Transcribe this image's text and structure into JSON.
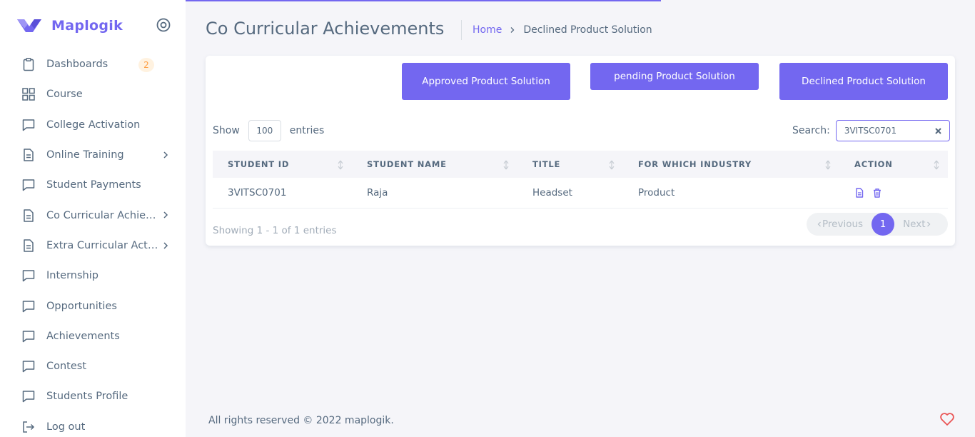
{
  "brand": {
    "name": "Maplogik",
    "accent": "#7367f0"
  },
  "sidebar": {
    "items": [
      {
        "label": "Dashboards",
        "icon": "clipboard-icon",
        "badge": "2"
      },
      {
        "label": "Course",
        "icon": "grid-icon"
      },
      {
        "label": "College Activation",
        "icon": "message-square-icon"
      },
      {
        "label": "Online Training",
        "icon": "file-text-icon",
        "has_submenu": true
      },
      {
        "label": "Student Payments",
        "icon": "message-square-icon"
      },
      {
        "label": "Co Curricular Achievements",
        "icon": "file-text-icon",
        "has_submenu": true
      },
      {
        "label": "Extra Curricular Activities",
        "icon": "file-text-icon",
        "has_submenu": true
      },
      {
        "label": "Internship",
        "icon": "message-square-icon"
      },
      {
        "label": "Opportunities",
        "icon": "message-square-icon"
      },
      {
        "label": "Achievements",
        "icon": "message-square-icon"
      },
      {
        "label": "Contest",
        "icon": "message-square-icon"
      },
      {
        "label": "Students Profile",
        "icon": "message-square-icon"
      },
      {
        "label": "Log out",
        "icon": "logout-icon"
      }
    ]
  },
  "header": {
    "title": "Co Curricular Achievements",
    "breadcrumb": {
      "home": "Home",
      "current": "Declined Product Solution"
    }
  },
  "tabs": {
    "approved": "Approved Product Solution",
    "pending": "pending Product Solution",
    "declined": "Declined Product Solution"
  },
  "table_controls": {
    "show_label": "Show",
    "length_value": "100",
    "entries_label": "entries",
    "search_label": "Search:",
    "search_value": "3VITSC0701"
  },
  "table": {
    "columns": [
      "STUDENT ID",
      "STUDENT NAME",
      "TITLE",
      "FOR WHICH INDUSTRY",
      "ACTION"
    ],
    "rows": [
      {
        "student_id": "3VITSC0701",
        "student_name": "Raja",
        "title": "Headset",
        "industry": "Product"
      }
    ]
  },
  "pagination": {
    "info": "Showing 1 - 1 of 1 entries",
    "previous": "Previous",
    "current": "1",
    "next": "Next"
  },
  "footer": {
    "text": "All rights reserved © 2022 maplogik."
  }
}
